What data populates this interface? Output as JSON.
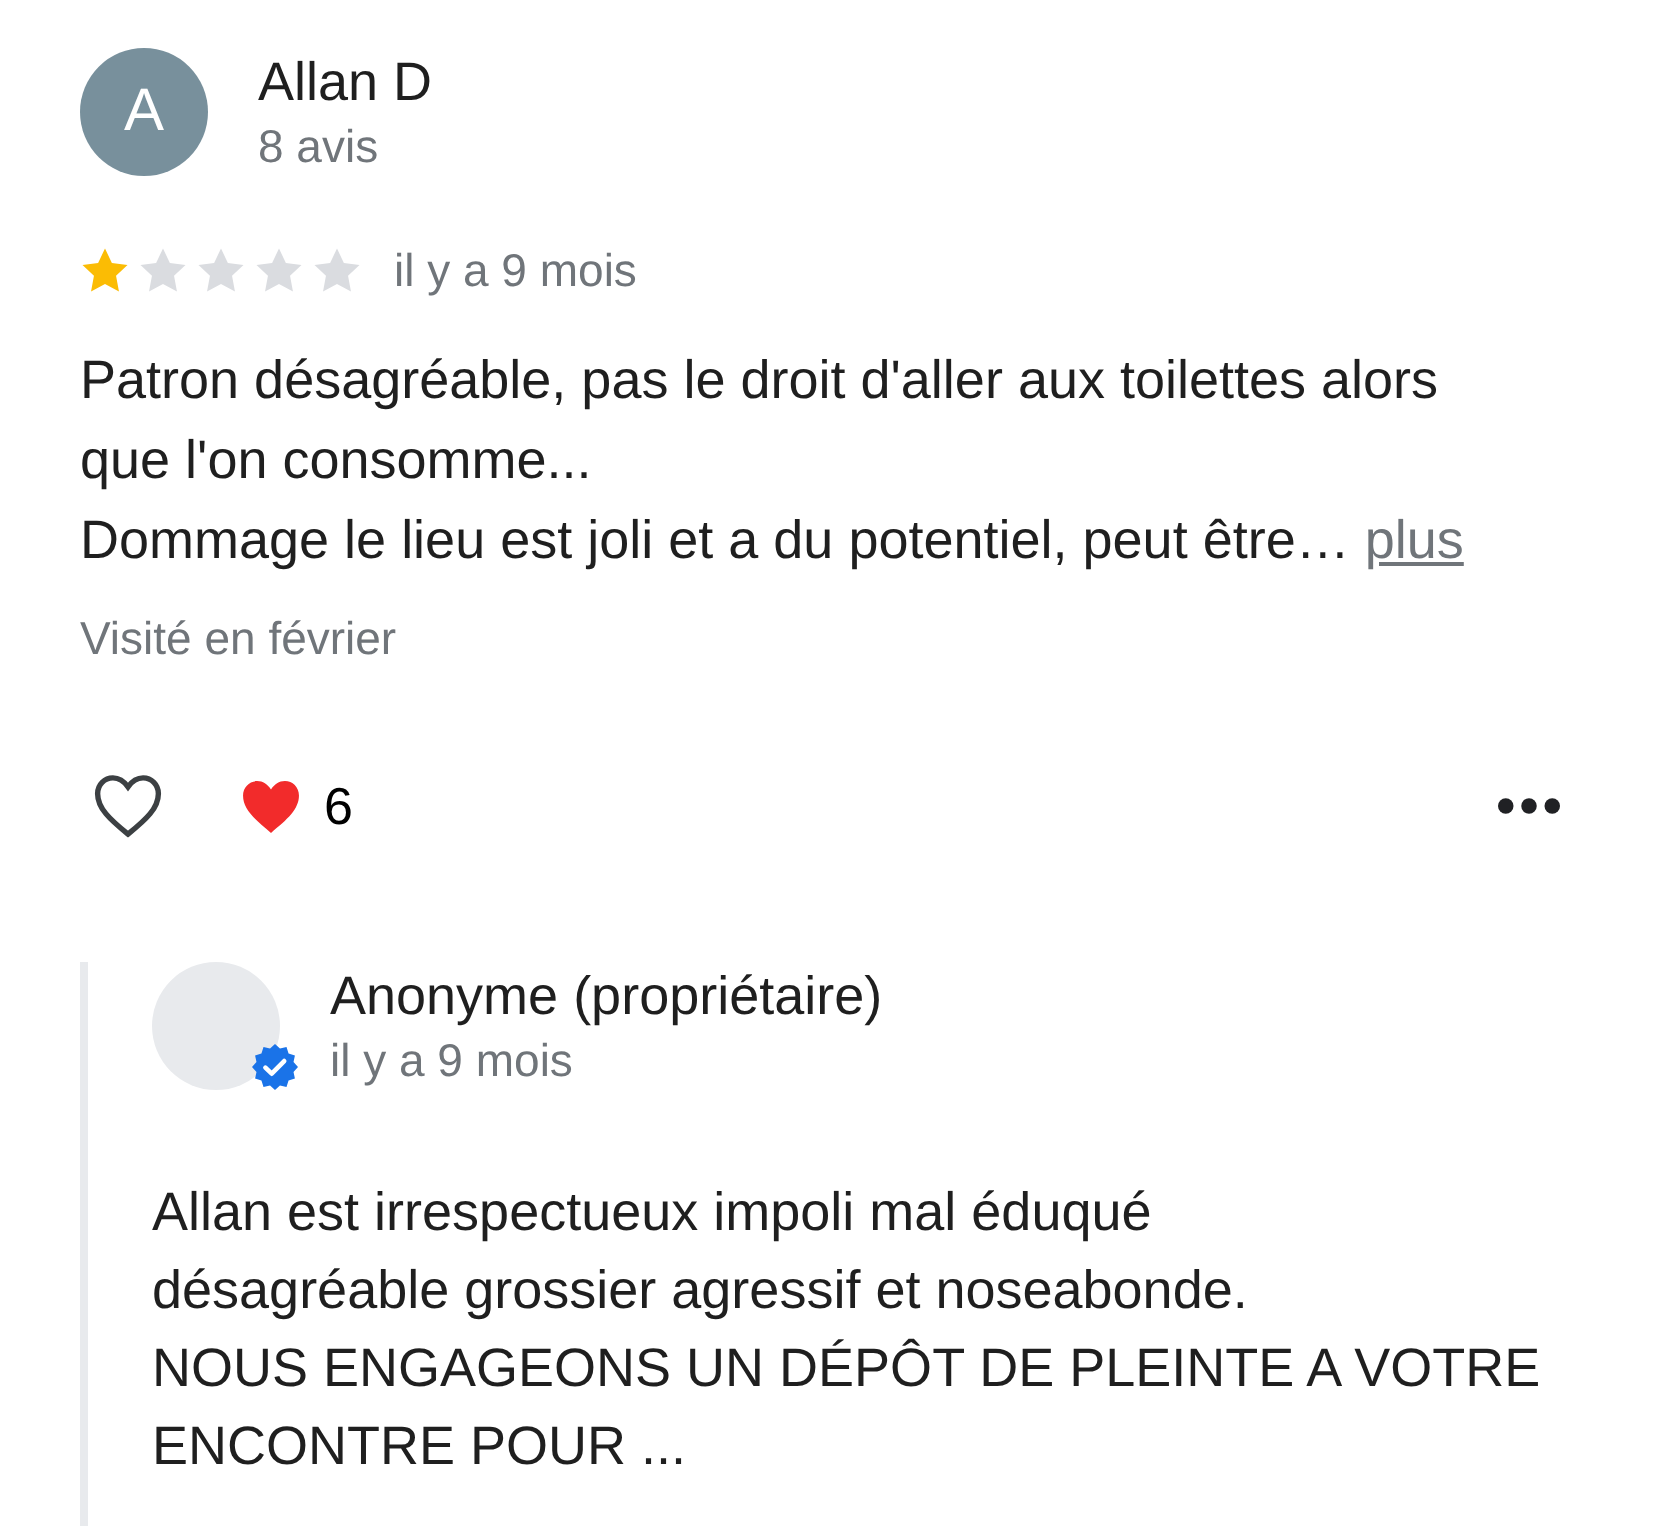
{
  "review": {
    "author": {
      "initial": "A",
      "name": "Allan D",
      "review_count": "8 avis"
    },
    "stars": 1,
    "date": "il y a 9 mois",
    "text": "Patron désagréable, pas le droit d'aller aux toilettes alors que l'on consomme...\nDommage le lieu est joli et a du potentiel, peut être…",
    "more_link": "plus",
    "visited": "Visité en février",
    "liked": false,
    "reaction_count": "6"
  },
  "owner_reply": {
    "name": "Anonyme (propriétaire)",
    "verified": true,
    "date": "il y a 9 mois",
    "text": "Allan est irrespectueux impoli mal éduqué\ndésagréable grossier agressif et noseabonde.\nNOUS ENGAGEONS UN DÉPÔT DE PLEINTE A VOTRE ENCONTRE POUR ..."
  }
}
